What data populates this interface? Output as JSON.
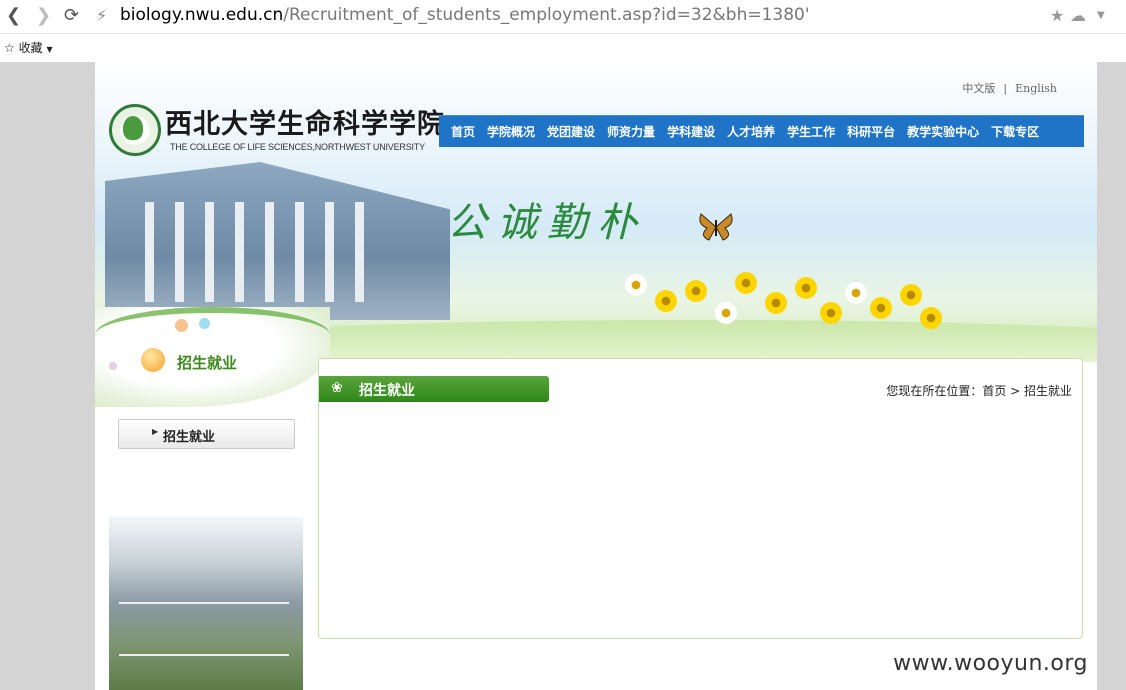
{
  "browser": {
    "url_host": "biology.nwu.edu.cn",
    "url_path": "/Recruitment_of_students_employment.asp?id=32&bh=1380'",
    "bookmarks_label": "收藏",
    "back_icon": "back-arrow-icon",
    "forward_icon": "forward-arrow-icon",
    "reload_icon": "reload-icon"
  },
  "header": {
    "lang_cn": "中文版",
    "lang_sep": "|",
    "lang_en": "English",
    "logo_cn": "西北大学生命科学学院",
    "logo_en": "THE COLLEGE OF LIFE SCIENCES,NORTHWEST UNIVERSITY",
    "motto": "公诚勤朴"
  },
  "nav": {
    "items": [
      "首页",
      "学院概况",
      "党团建设",
      "师资力量",
      "学科建设",
      "人才培养",
      "学生工作",
      "科研平台",
      "教学实验中心",
      "下载专区"
    ]
  },
  "sidebar": {
    "title": "招生就业",
    "menu_item": "招生就业"
  },
  "main": {
    "tab_title": "招生就业",
    "breadcrumb": "您现在所在位置：首页 > 招生就业"
  },
  "watermark": "www.wooyun.org",
  "colors": {
    "nav_blue": "#1f74c8",
    "green": "#3c8a1e"
  }
}
